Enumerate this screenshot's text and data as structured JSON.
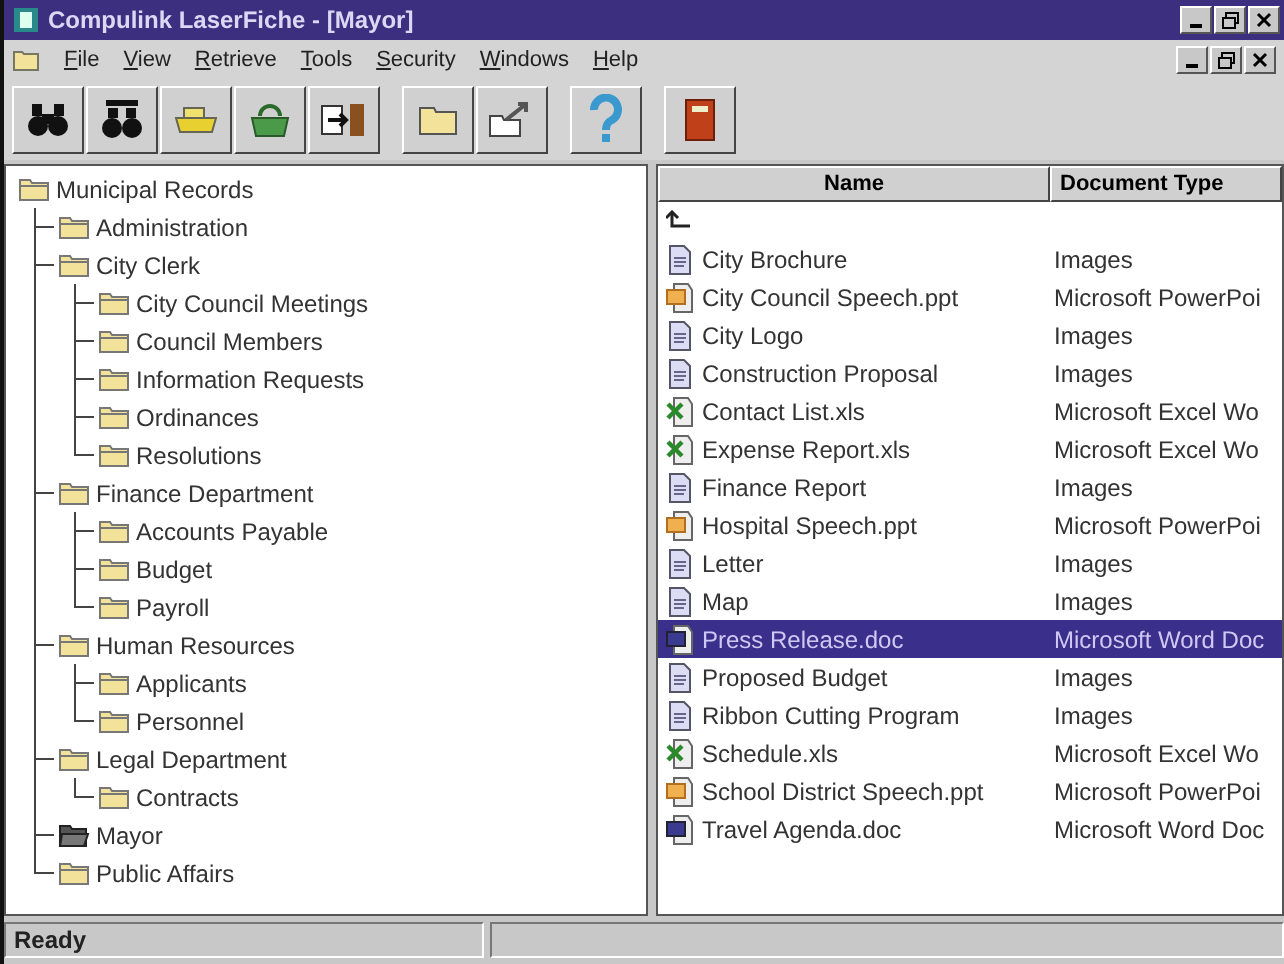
{
  "window": {
    "title": "Compulink LaserFiche - [Mayor]"
  },
  "menu": [
    "File",
    "View",
    "Retrieve",
    "Tools",
    "Security",
    "Windows",
    "Help"
  ],
  "toolbar": [
    {
      "kind": "search"
    },
    {
      "kind": "search-list"
    },
    {
      "kind": "scanner"
    },
    {
      "kind": "bag"
    },
    {
      "kind": "exit"
    },
    {
      "kind": "folder"
    },
    {
      "kind": "folder-move"
    },
    {
      "kind": "help"
    },
    {
      "kind": "book"
    }
  ],
  "tree": {
    "label": "Municipal Records",
    "open": false,
    "children": [
      {
        "label": "Administration",
        "open": false
      },
      {
        "label": "City Clerk",
        "open": false,
        "children": [
          {
            "label": "City Council Meetings",
            "open": false
          },
          {
            "label": "Council Members",
            "open": false
          },
          {
            "label": "Information Requests",
            "open": false
          },
          {
            "label": "Ordinances",
            "open": false
          },
          {
            "label": "Resolutions",
            "open": false
          }
        ]
      },
      {
        "label": "Finance Department",
        "open": false,
        "children": [
          {
            "label": "Accounts Payable",
            "open": false
          },
          {
            "label": "Budget",
            "open": false
          },
          {
            "label": "Payroll",
            "open": false
          }
        ]
      },
      {
        "label": "Human Resources",
        "open": false,
        "children": [
          {
            "label": "Applicants",
            "open": false
          },
          {
            "label": "Personnel",
            "open": false
          }
        ]
      },
      {
        "label": "Legal Department",
        "open": false,
        "children": [
          {
            "label": "Contracts",
            "open": false
          }
        ]
      },
      {
        "label": "Mayor",
        "open": true
      },
      {
        "label": "Public Affairs",
        "open": false
      }
    ]
  },
  "table": {
    "columns": [
      "Name",
      "Document Type"
    ],
    "rows": [
      {
        "kind": "image",
        "name": "City Brochure",
        "type": "Images",
        "selected": false
      },
      {
        "kind": "ppt",
        "name": "City Council Speech.ppt",
        "type": "Microsoft PowerPoi",
        "selected": false
      },
      {
        "kind": "image",
        "name": "City Logo",
        "type": "Images",
        "selected": false
      },
      {
        "kind": "image",
        "name": "Construction Proposal",
        "type": "Images",
        "selected": false
      },
      {
        "kind": "xls",
        "name": "Contact List.xls",
        "type": "Microsoft Excel Wo",
        "selected": false
      },
      {
        "kind": "xls",
        "name": "Expense Report.xls",
        "type": "Microsoft Excel Wo",
        "selected": false
      },
      {
        "kind": "image",
        "name": "Finance Report",
        "type": "Images",
        "selected": false
      },
      {
        "kind": "ppt",
        "name": "Hospital Speech.ppt",
        "type": "Microsoft PowerPoi",
        "selected": false
      },
      {
        "kind": "image",
        "name": "Letter",
        "type": "Images",
        "selected": false
      },
      {
        "kind": "image",
        "name": "Map",
        "type": "Images",
        "selected": false
      },
      {
        "kind": "doc",
        "name": "Press Release.doc",
        "type": "Microsoft Word Doc",
        "selected": true
      },
      {
        "kind": "image",
        "name": "Proposed Budget",
        "type": "Images",
        "selected": false
      },
      {
        "kind": "image",
        "name": "Ribbon Cutting Program",
        "type": "Images",
        "selected": false
      },
      {
        "kind": "xls",
        "name": "Schedule.xls",
        "type": "Microsoft Excel Wo",
        "selected": false
      },
      {
        "kind": "ppt",
        "name": "School District Speech.ppt",
        "type": "Microsoft PowerPoi",
        "selected": false
      },
      {
        "kind": "doc",
        "name": "Travel Agenda.doc",
        "type": "Microsoft Word Doc",
        "selected": false
      }
    ]
  },
  "status_bar": {
    "text": "Ready"
  }
}
